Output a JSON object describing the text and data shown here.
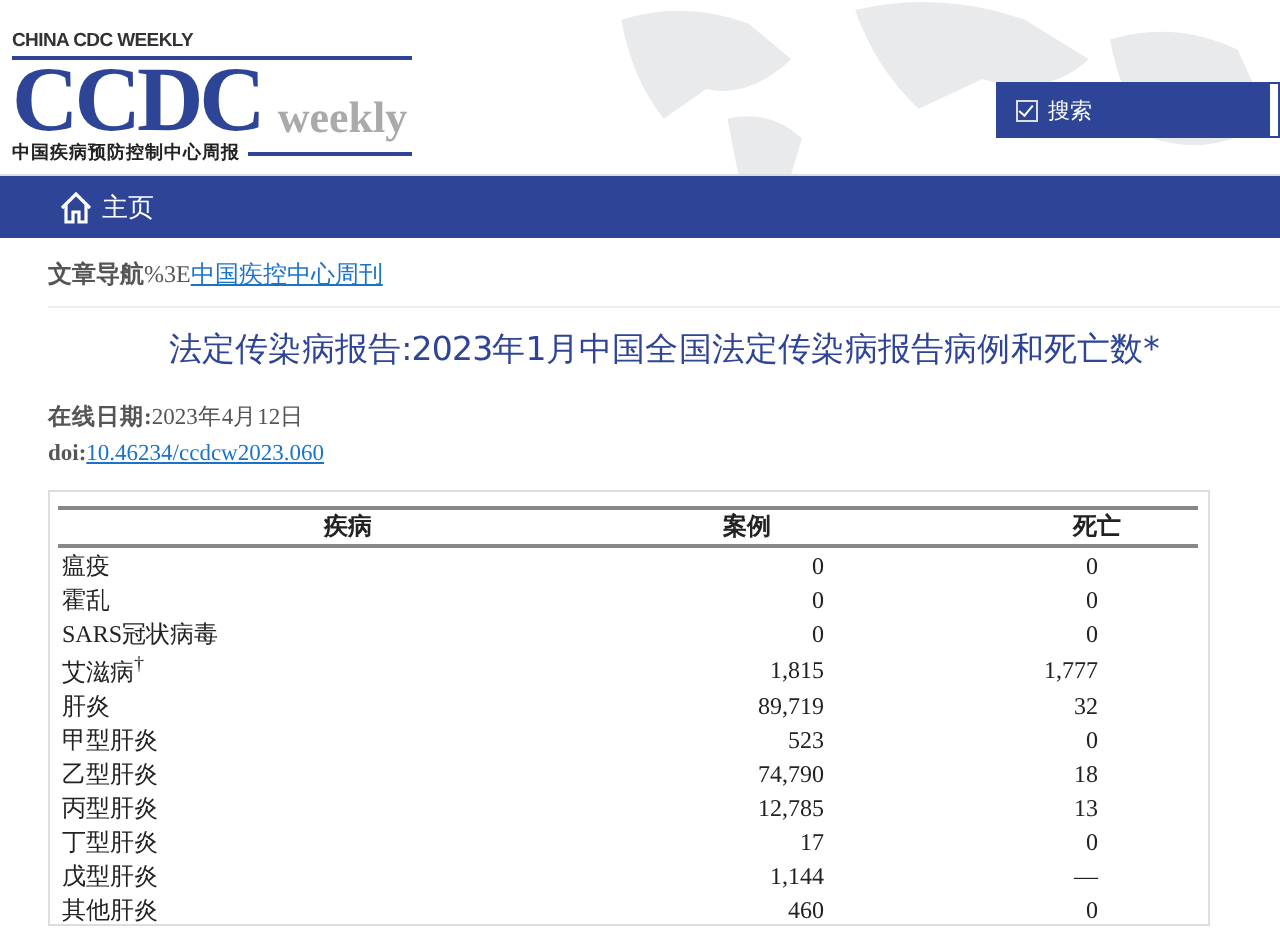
{
  "logo": {
    "top_line": "CHINA CDC WEEKLY",
    "mark": "CCDC",
    "mark_suffix": "weekly",
    "subtitle": "中国疾病预防控制中心周报"
  },
  "search": {
    "label": "搜索",
    "checked": true
  },
  "nav": {
    "home": "主页"
  },
  "breadcrumb": {
    "label": "文章导航",
    "separator": "%3E",
    "link": "中国疾控中心周刊"
  },
  "article": {
    "title": "法定传染病报告:2023年1月中国全国法定传染病报告病例和死亡数*",
    "date_label": "在线日期:",
    "date": "2023年4月12日",
    "doi_label": "doi:",
    "doi": "10.46234/ccdcw2023.060"
  },
  "table": {
    "columns": [
      "疾病",
      "案例",
      "死亡"
    ],
    "rows": [
      {
        "disease": "瘟疫",
        "cases": "0",
        "deaths": "0"
      },
      {
        "disease": "霍乱",
        "cases": "0",
        "deaths": "0"
      },
      {
        "disease": "SARS冠状病毒",
        "cases": "0",
        "deaths": "0"
      },
      {
        "disease": "艾滋病$^{†}$",
        "cases": "1,815",
        "deaths": "1,777"
      },
      {
        "disease": "肝炎",
        "cases": "89,719",
        "deaths": "32"
      },
      {
        "disease": "甲型肝炎",
        "cases": "523",
        "deaths": "0"
      },
      {
        "disease": "乙型肝炎",
        "cases": "74,790",
        "deaths": "18"
      },
      {
        "disease": "丙型肝炎",
        "cases": "12,785",
        "deaths": "13"
      },
      {
        "disease": "丁型肝炎",
        "cases": "17",
        "deaths": "0"
      },
      {
        "disease": "戊型肝炎",
        "cases": "1,144",
        "deaths": "—"
      },
      {
        "disease": "其他肝炎",
        "cases": "460",
        "deaths": "0"
      }
    ]
  }
}
